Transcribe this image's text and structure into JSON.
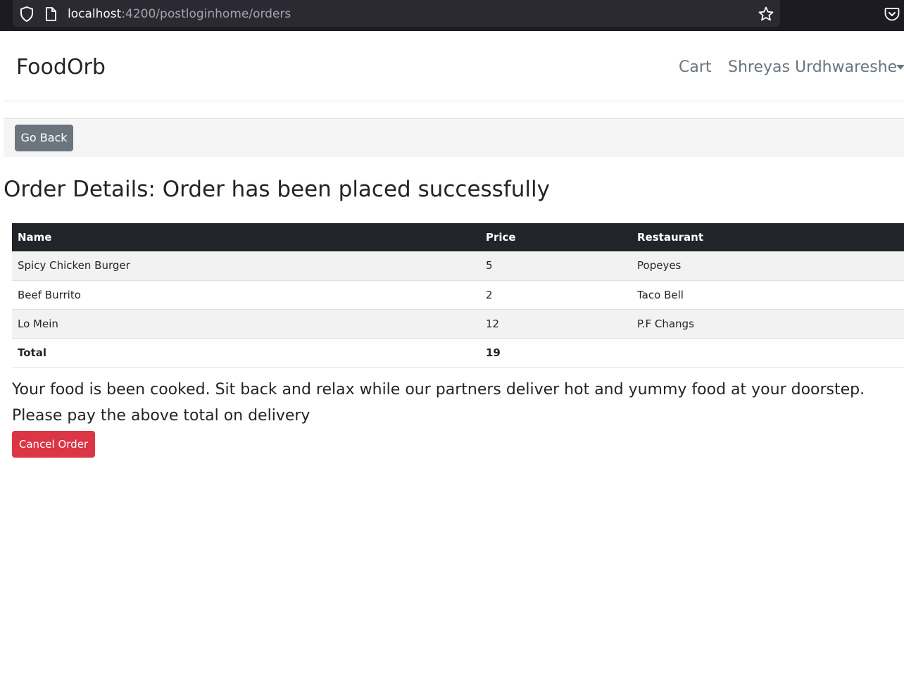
{
  "browser": {
    "url_host": "localhost",
    "url_rest": ":4200/postloginhome/orders",
    "icons": [
      "shield-icon",
      "page-icon",
      "star-icon",
      "pocket-icon"
    ]
  },
  "navbar": {
    "brand": "FoodOrb",
    "cart_label": "Cart",
    "user_name": "Shreyas Urdhwareshe"
  },
  "toolbar": {
    "back_label": "Go Back"
  },
  "page_title": "Order Details: Order has been placed successfully",
  "table": {
    "headers": [
      "Name",
      "Price",
      "Restaurant"
    ],
    "rows": [
      {
        "name": "Spicy Chicken Burger",
        "price": "5",
        "restaurant": "Popeyes"
      },
      {
        "name": "Beef Burrito",
        "price": "2",
        "restaurant": "Taco Bell"
      },
      {
        "name": "Lo Mein",
        "price": "12",
        "restaurant": "P.F Changs"
      }
    ],
    "total_label": "Total",
    "total_value": "19"
  },
  "messages": {
    "line1": "Your food is been cooked. Sit back and relax while our partners deliver hot and yummy food at your doorstep.",
    "line2": "Please pay the above total on delivery"
  },
  "actions": {
    "cancel_label": "Cancel Order"
  },
  "colors": {
    "browser_bg": "#1c1b22",
    "table_header_bg": "#212529",
    "secondary_button": "#6c757d",
    "danger_button": "#dc3545"
  }
}
